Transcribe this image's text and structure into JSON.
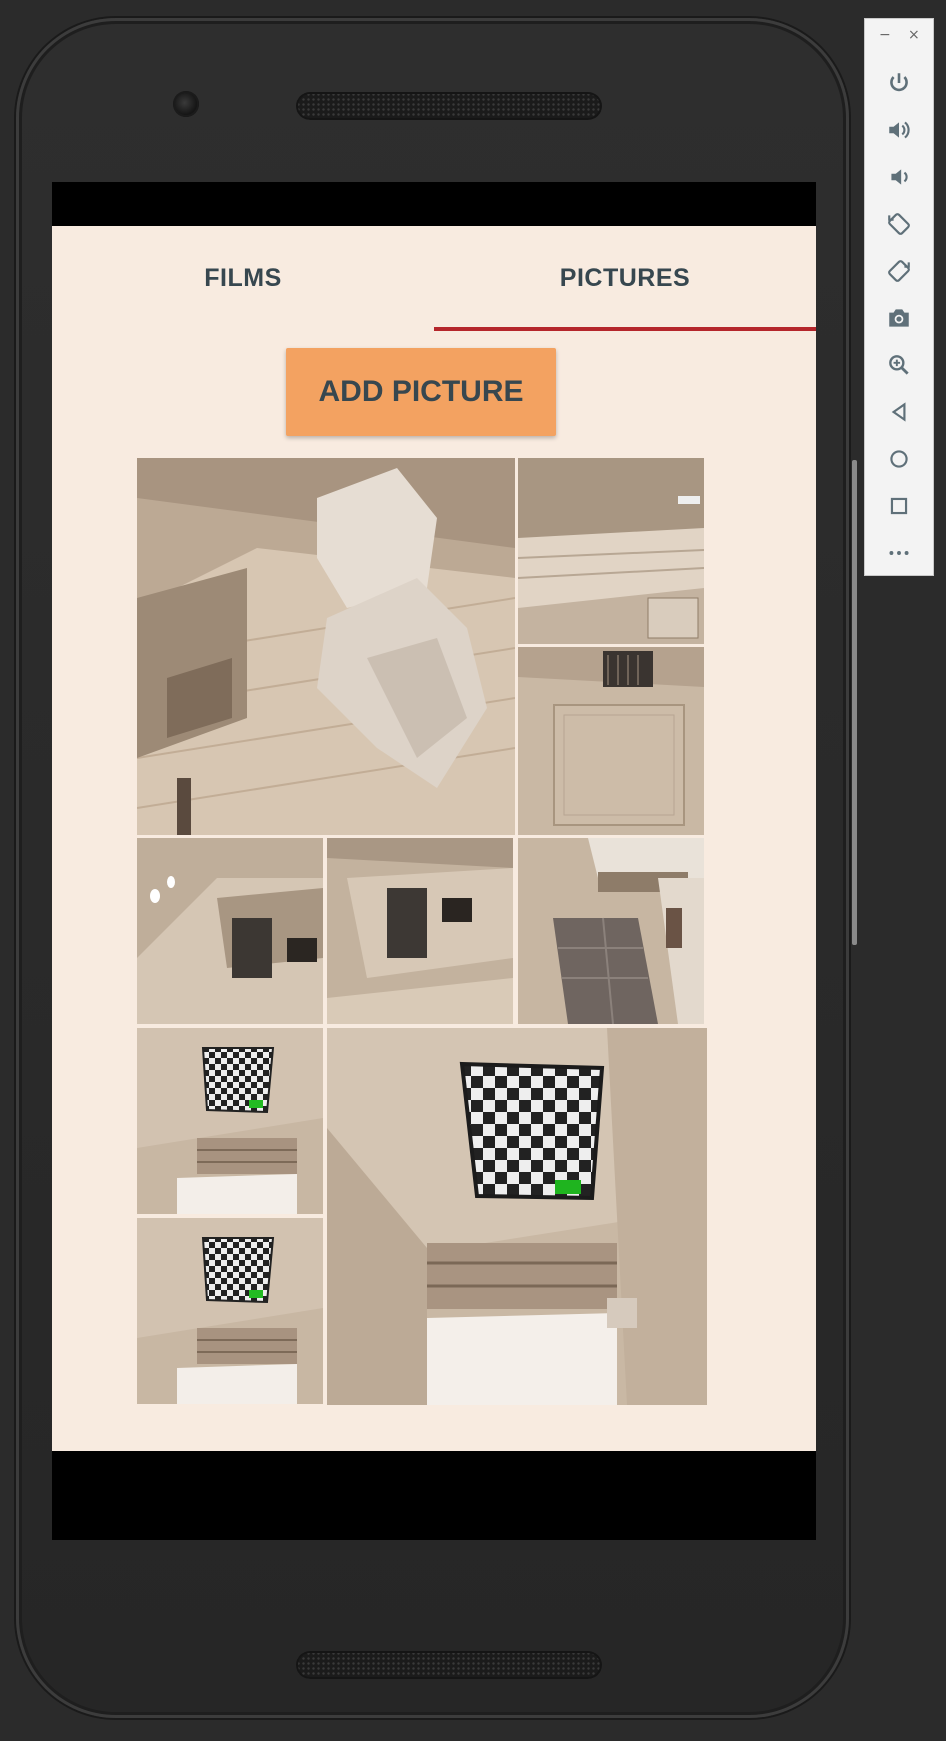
{
  "app": {
    "tabs": [
      {
        "label": "FILMS",
        "selected": false
      },
      {
        "label": "PICTURES",
        "selected": true
      }
    ],
    "add_button_label": "ADD PICTURE",
    "accent_color": "#b5262b",
    "button_color": "#f3a261",
    "background_color": "#f8ebe0"
  },
  "gallery": {
    "tiles": [
      {
        "name": "tile-1",
        "content": "room-ceiling-deer-head"
      },
      {
        "name": "tile-2",
        "content": "room-ceiling-shelf"
      },
      {
        "name": "tile-3",
        "content": "room-door-oven"
      },
      {
        "name": "tile-4",
        "content": "kitchen-oven-left"
      },
      {
        "name": "tile-5",
        "content": "kitchen-oven-right"
      },
      {
        "name": "tile-6",
        "content": "living-room-sofa"
      },
      {
        "name": "tile-7",
        "content": "checkerboard-room-small-top"
      },
      {
        "name": "tile-8",
        "content": "checkerboard-room-small-bottom"
      },
      {
        "name": "tile-9",
        "content": "checkerboard-room-large"
      }
    ]
  },
  "emulator_toolbar": {
    "minimize": "−",
    "close": "×",
    "buttons": [
      "power-icon",
      "volume-up-icon",
      "volume-down-icon",
      "rotate-left-icon",
      "rotate-right-icon",
      "camera-icon",
      "zoom-icon",
      "back-icon",
      "home-icon",
      "overview-icon",
      "more-icon"
    ]
  }
}
